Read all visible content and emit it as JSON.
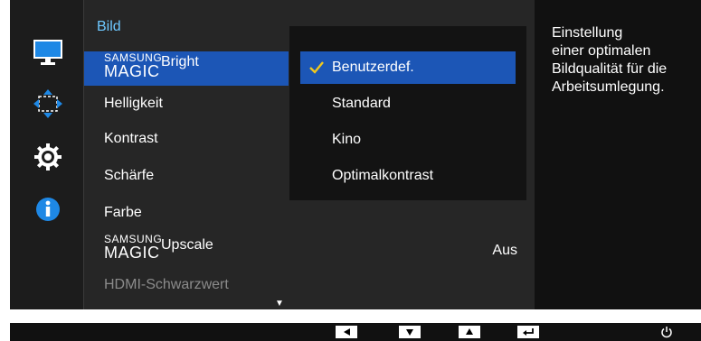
{
  "menu": {
    "title": "Bild",
    "items": [
      {
        "prefix_top": "SAMSUNG",
        "prefix_bottom": "MAGIC",
        "label": "Bright"
      },
      {
        "label": "Helligkeit"
      },
      {
        "label": "Kontrast"
      },
      {
        "label": "Schärfe"
      },
      {
        "label": "Farbe"
      },
      {
        "prefix_top": "SAMSUNG",
        "prefix_bottom": "MAGIC",
        "label": "Upscale",
        "value": "Aus"
      },
      {
        "label": "HDMI-Schwarzwert"
      }
    ]
  },
  "submenu": {
    "items": [
      {
        "label": "Benutzerdef."
      },
      {
        "label": "Standard"
      },
      {
        "label": "Kino"
      },
      {
        "label": "Optimalkontrast"
      }
    ]
  },
  "description": {
    "lines": [
      "Einstellung",
      "einer optimalen",
      "Bildqualität für die",
      "Arbeitsumlegung."
    ]
  },
  "icons": {
    "sidebar": [
      "monitor-icon",
      "move-arrows-icon",
      "gear-icon",
      "info-icon"
    ],
    "buttons": [
      "left-arrow-icon",
      "down-arrow-icon",
      "up-arrow-icon",
      "enter-icon",
      "power-icon"
    ],
    "check": "checkmark-icon",
    "scroll": "scroll-down-icon"
  },
  "colors": {
    "highlight": "#1c56b6",
    "title": "#6ec8ff",
    "check": "#f0c81d",
    "icon_blue": "#1e88e5"
  }
}
